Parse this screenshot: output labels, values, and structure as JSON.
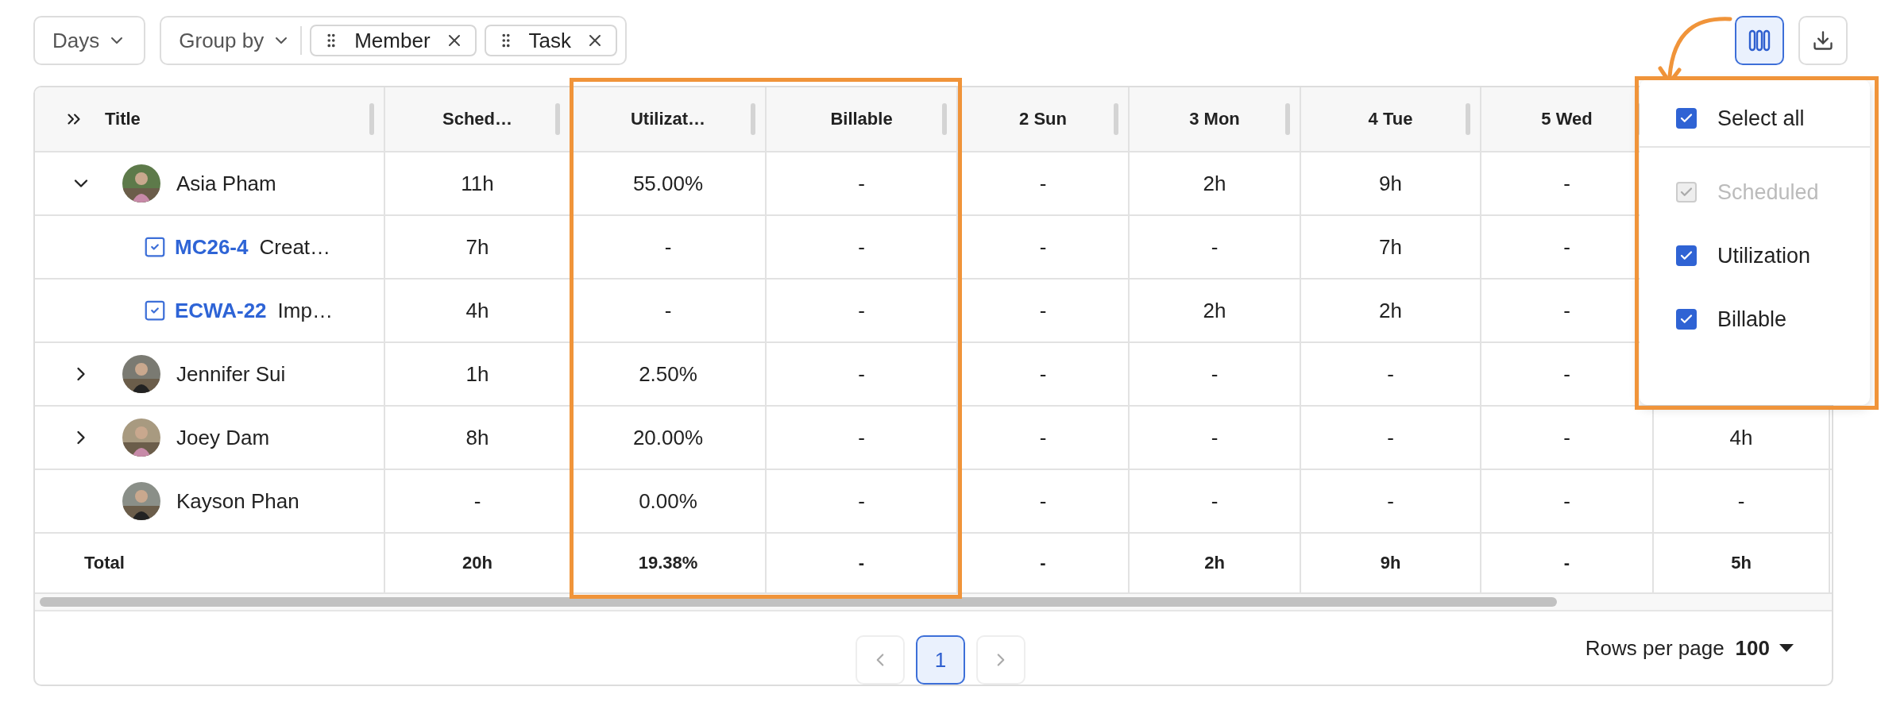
{
  "toolbar": {
    "days": {
      "label": "Days"
    },
    "group_by": {
      "label": "Group by",
      "chips": [
        {
          "label": "Member"
        },
        {
          "label": "Task"
        }
      ]
    },
    "column_button": {
      "selected": true
    }
  },
  "table": {
    "title_column": "Title",
    "columns": [
      "Sched…",
      "Utilizat…",
      "Billable",
      "2 Sun",
      "3 Mon",
      "4 Tue",
      "5 Wed"
    ],
    "rows": [
      {
        "kind": "member",
        "name": "Asia Pham",
        "expanded": true,
        "cells": [
          "11h",
          "55.00%",
          "-",
          "-",
          "2h",
          "9h",
          "-"
        ],
        "children": [
          {
            "kind": "task",
            "key": "MC26-4",
            "title": "Creat…",
            "cells": [
              "7h",
              "-",
              "-",
              "-",
              "-",
              "7h",
              "-"
            ]
          },
          {
            "kind": "task",
            "key": "ECWA-22",
            "title": "Imp…",
            "cells": [
              "4h",
              "-",
              "-",
              "-",
              "2h",
              "2h",
              "-"
            ]
          }
        ]
      },
      {
        "kind": "member",
        "name": "Jennifer Sui",
        "expanded": false,
        "cells": [
          "1h",
          "2.50%",
          "-",
          "-",
          "-",
          "-",
          "-"
        ]
      },
      {
        "kind": "member",
        "name": "Joey Dam",
        "expanded": false,
        "cells": [
          "8h",
          "20.00%",
          "-",
          "-",
          "-",
          "-",
          "-",
          "4h"
        ]
      },
      {
        "kind": "member_leaf",
        "name": "Kayson Phan",
        "cells": [
          "-",
          "0.00%",
          "-",
          "-",
          "-",
          "-",
          "-",
          "-"
        ]
      }
    ],
    "total": {
      "label": "Total",
      "cells": [
        "20h",
        "19.38%",
        "-",
        "-",
        "2h",
        "9h",
        "-",
        "5h"
      ]
    }
  },
  "column_menu": {
    "items": [
      {
        "kind": "select_all",
        "label": "Select all",
        "checked": true,
        "disabled": false
      },
      {
        "kind": "column",
        "label": "Scheduled",
        "checked": true,
        "disabled": true
      },
      {
        "kind": "column",
        "label": "Utilization",
        "checked": true,
        "disabled": false
      },
      {
        "kind": "column",
        "label": "Billable",
        "checked": true,
        "disabled": false
      }
    ]
  },
  "pagination": {
    "pages": [
      {
        "label": "1",
        "selected": true
      }
    ],
    "rows_per_page_label": "Rows per page",
    "rows_per_page": "100"
  }
}
